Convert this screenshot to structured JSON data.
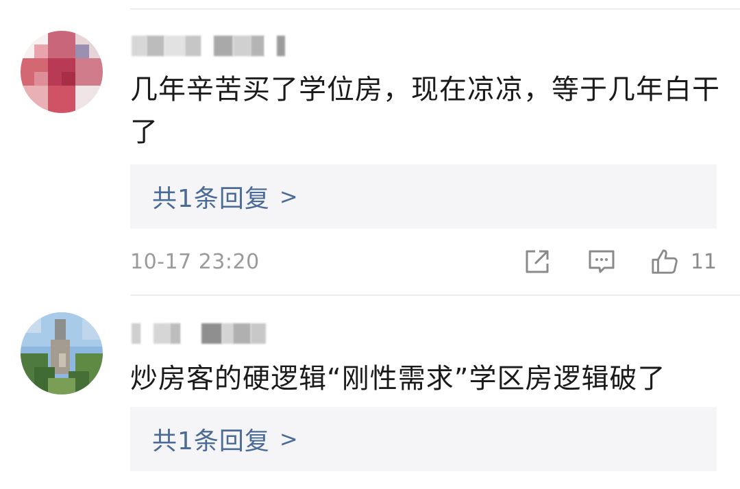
{
  "comments": [
    {
      "username": "████ ██",
      "text": "几年辛苦买了学位房，现在凉凉，等于几年白干了",
      "reply_label": "共1条回复",
      "reply_chevron": ">",
      "timestamp": "10-17 23:20",
      "like_count": "11"
    },
    {
      "username": "██ ███",
      "text": "炒房客的硬逻辑“刚性需求”学区房逻辑破了",
      "reply_label": "共1条回复",
      "reply_chevron": ">"
    }
  ],
  "icons": {
    "share": "share-icon",
    "comment": "comment-icon",
    "like": "thumbs-up-icon"
  },
  "colors": {
    "reply_link": "#4a6b96",
    "reply_bg": "#f5f5f7",
    "meta_gray": "#9a9a9a"
  }
}
